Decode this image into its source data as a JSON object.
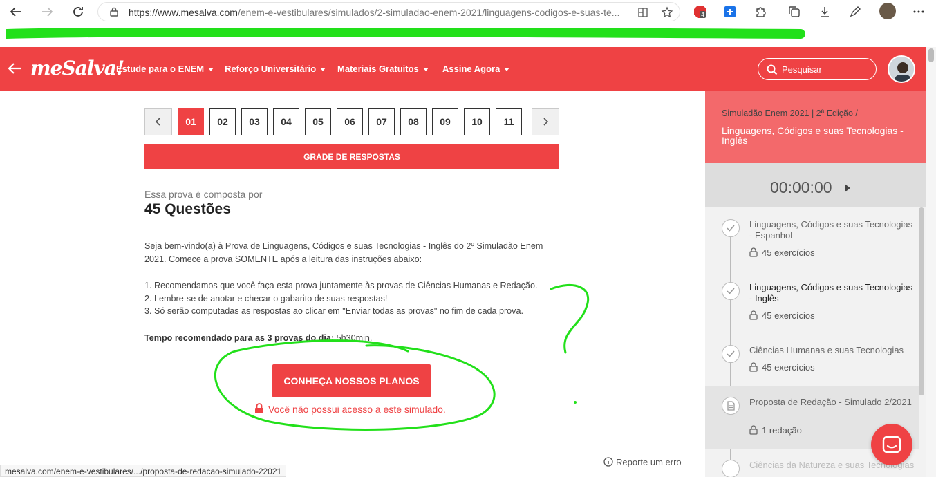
{
  "browser": {
    "url_main": "https://www.mesalva.com",
    "url_rest": "/enem-e-vestibulares/simulados/2-simuladao-enem-2021/linguagens-codigos-e-suas-te...",
    "abp_badge": "4"
  },
  "header": {
    "logo": "meSalva!",
    "nav": [
      {
        "label": "Estude para o ENEM"
      },
      {
        "label": "Reforço Universitário"
      },
      {
        "label": "Materiais Gratuitos"
      },
      {
        "label": "Assine Agora"
      }
    ],
    "search_label": "Pesquisar"
  },
  "pager": {
    "pages": [
      "01",
      "02",
      "03",
      "04",
      "05",
      "06",
      "07",
      "08",
      "09",
      "10",
      "11"
    ],
    "active": "01"
  },
  "main": {
    "grade_button": "GRADE DE RESPOSTAS",
    "subtitle": "Essa prova é composta por",
    "title": "45 Questões",
    "intro_line1": "Seja bem-vindo(a) à Prova de Linguagens, Códigos e suas Tecnologias - Inglês do 2º Simuladão Enem",
    "intro_line2": "2021. Comece a prova SOMENTE após a leitura das instruções abaixo:",
    "rule1": "1. Recomendamos que você faça esta prova juntamente às provas de Ciências Humanas e Redação.",
    "rule2": "2. Lembre-se de anotar e checar o gabarito de suas respostas!",
    "rule3": "3. Só serão computadas as respostas ao clicar em \"Enviar todas as provas\" no fim de cada prova.",
    "time_label": "Tempo recomendado para as 3 provas do dia:",
    "time_value": "5h30min.",
    "plans_button": "CONHEÇA NOSSOS PLANOS",
    "no_access": "Você não possui acesso a este simulado.",
    "report": "Reporte um erro"
  },
  "status_url": "mesalva.com/enem-e-vestibulares/.../proposta-de-redacao-simulado-22021",
  "sidebar": {
    "crumb": "Simuladão Enem 2021 | 2ª Edição  /",
    "title": "Linguagens, Códigos e suas Tecnologias - Inglês",
    "timer": "00:00:00",
    "items": [
      {
        "title": "Linguagens, Códigos e suas Tecnologias - Espanhol",
        "meta": "45  exercícios"
      },
      {
        "title": "Linguagens, Códigos e suas Tecnologias - Inglês",
        "meta": "45  exercícios"
      },
      {
        "title": "Ciências Humanas e suas Tecnologias",
        "meta": "45  exercícios"
      },
      {
        "title": "Proposta de Redação - Simulado 2/2021",
        "meta": "1  redação"
      },
      {
        "title": "Ciências da Natureza e suas Tecnologias",
        "meta": ""
      }
    ]
  },
  "colors": {
    "brand_red": "#ef4244",
    "annotation_green": "#22e01a"
  }
}
